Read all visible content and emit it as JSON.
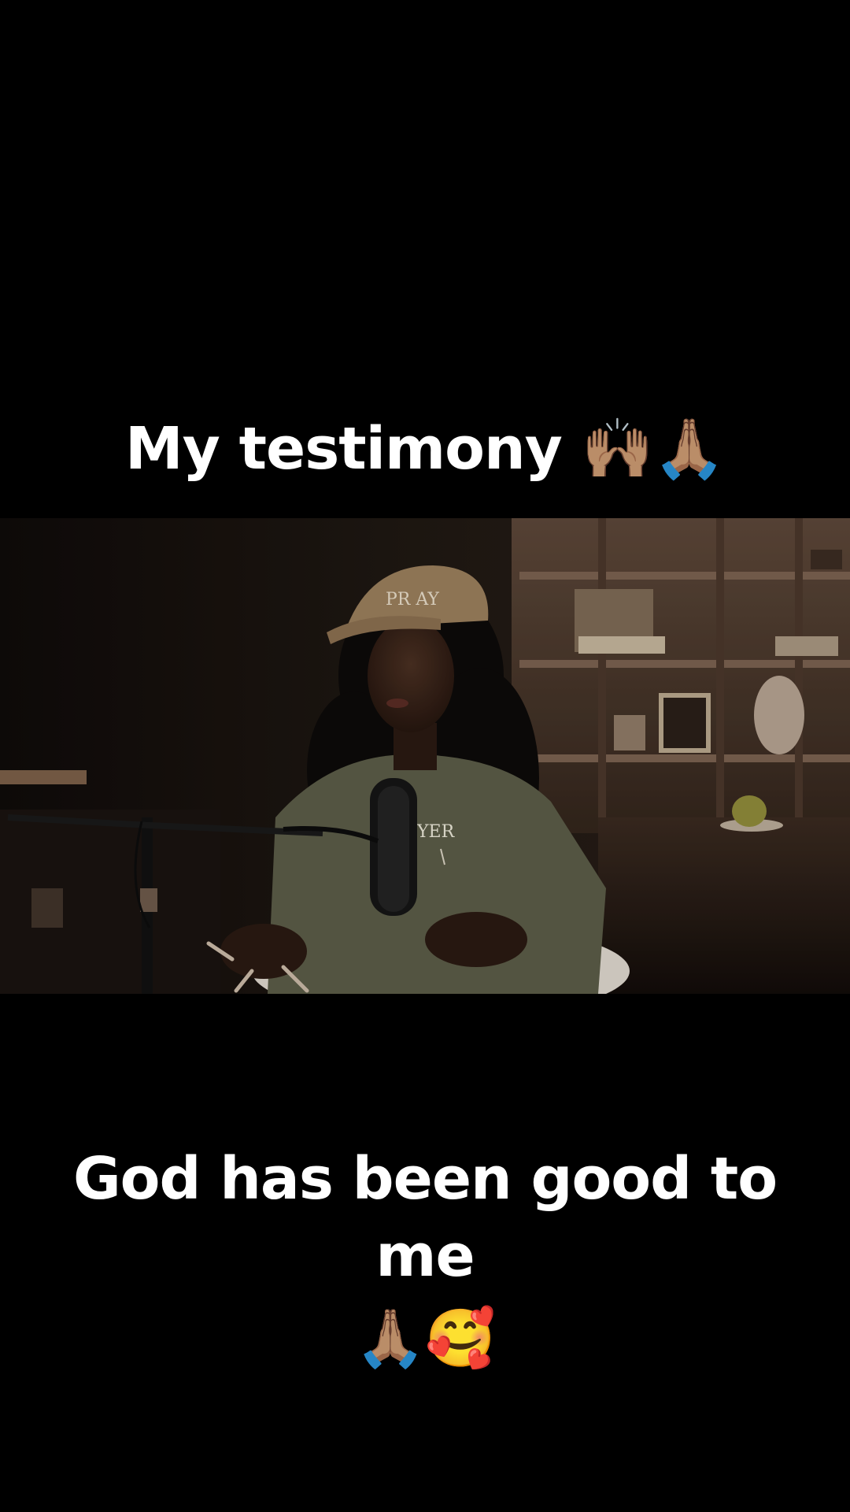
{
  "overlay": {
    "top_caption": "My testimony 🙌🏽🙏🏽",
    "bottom_caption_text": "God has been good to me",
    "bottom_caption_emojis": "🙏🏽🥰"
  },
  "video": {
    "cap_text": "PR AY",
    "shirt_text": "YER"
  },
  "colors": {
    "background": "#000000",
    "caption_text": "#ffffff",
    "studio_wall": "#140f0c",
    "shelf_wood": "#5a4434",
    "cap": "#9a7e5c",
    "shirt": "#5b5c47"
  }
}
